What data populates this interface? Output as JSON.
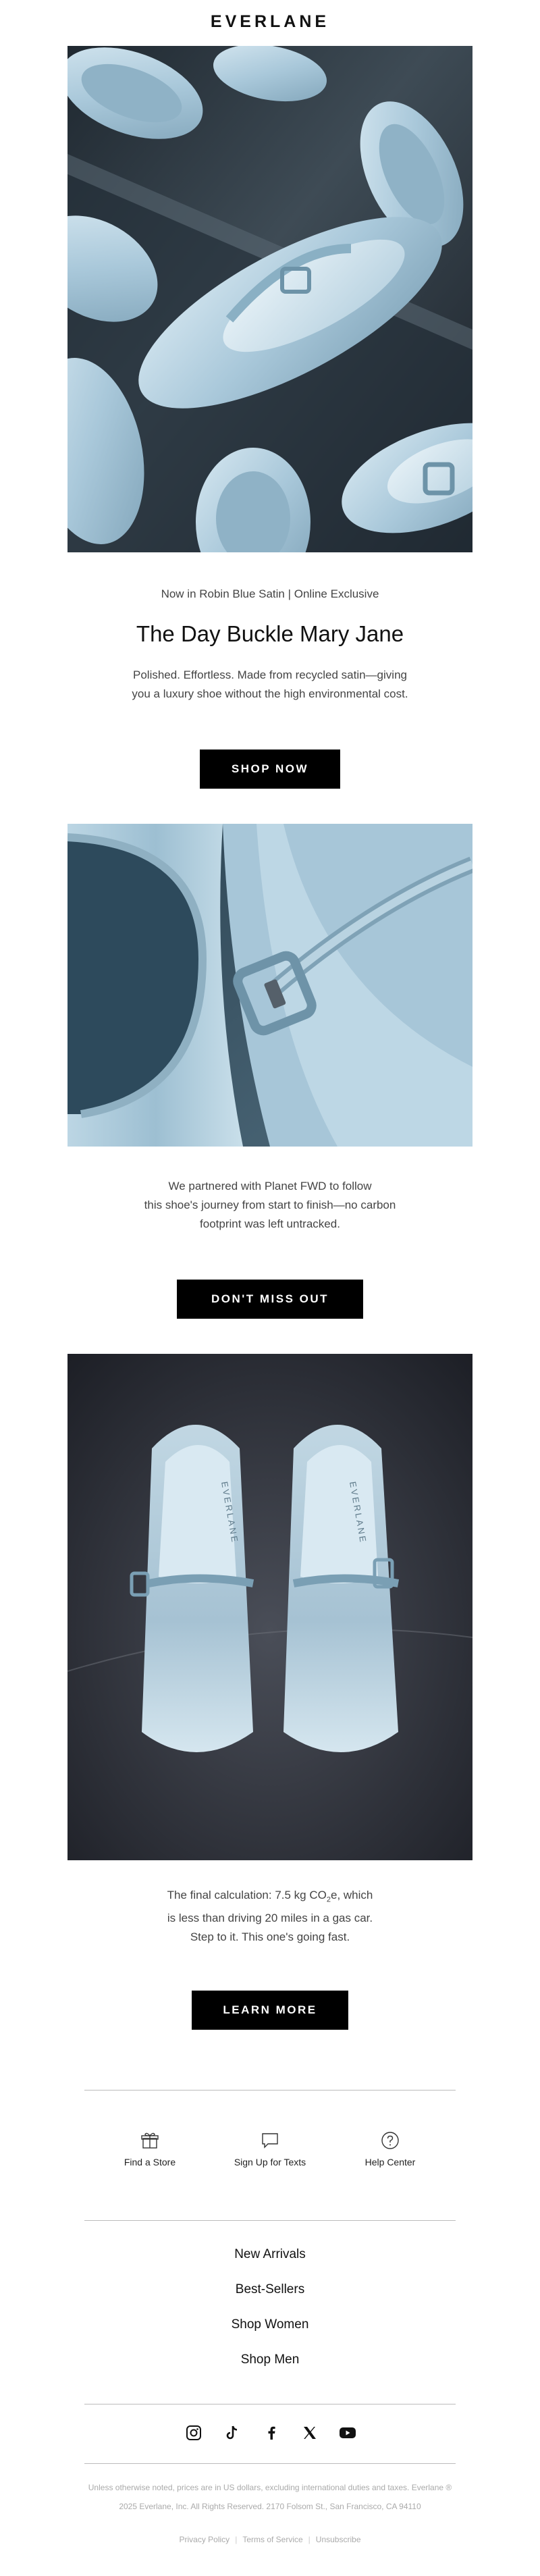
{
  "brand": {
    "logo_text": "EVERLANE"
  },
  "hero": {
    "eyebrow": "Now in Robin Blue Satin | Online Exclusive",
    "headline": "The Day Buckle Mary Jane",
    "body_line1": "Polished. Effortless. Made from recycled satin—giving",
    "body_line2": "you a luxury shoe without the high environmental cost.",
    "cta_label": "SHOP NOW"
  },
  "section_two": {
    "line1": "We partnered with Planet FWD to follow",
    "line2": "this shoe's journey from start to finish—no carbon",
    "line3": "footprint was left untracked.",
    "cta_label": "DON'T MISS OUT"
  },
  "section_three": {
    "line1_pre": "The final calculation: 7.5 kg CO",
    "line1_sub": "2",
    "line1_post": "e, which",
    "line2": "is less than driving 20 miles in a gas car.",
    "line3": "Step to it. This one's going fast.",
    "cta_label": "LEARN MORE",
    "shoe_brand_text": "EVERLANE"
  },
  "utilities": [
    {
      "label": "Find a Store",
      "icon": "gift-icon"
    },
    {
      "label": "Sign Up for Texts",
      "icon": "chat-bubble-icon"
    },
    {
      "label": "Help Center",
      "icon": "question-circle-icon"
    }
  ],
  "nav_links": [
    "New Arrivals",
    "Best-Sellers",
    "Shop Women",
    "Shop Men"
  ],
  "social_icons": [
    "instagram-icon",
    "tiktok-icon",
    "facebook-icon",
    "x-icon",
    "youtube-icon"
  ],
  "legal": {
    "line1": "Unless otherwise noted, prices are in US dollars, excluding international duties and taxes. Everlane ®",
    "line2": "2025 Everlane, Inc. All Rights Reserved. 2170 Folsom St., San Francisco, CA 94110",
    "links": [
      "Privacy Policy",
      "Terms of Service",
      "Unsubscribe"
    ]
  },
  "colors": {
    "cta_bg": "#000000",
    "cta_text": "#ffffff",
    "satin_blue": "#a9c8da",
    "rule": "#bbbbbb"
  }
}
